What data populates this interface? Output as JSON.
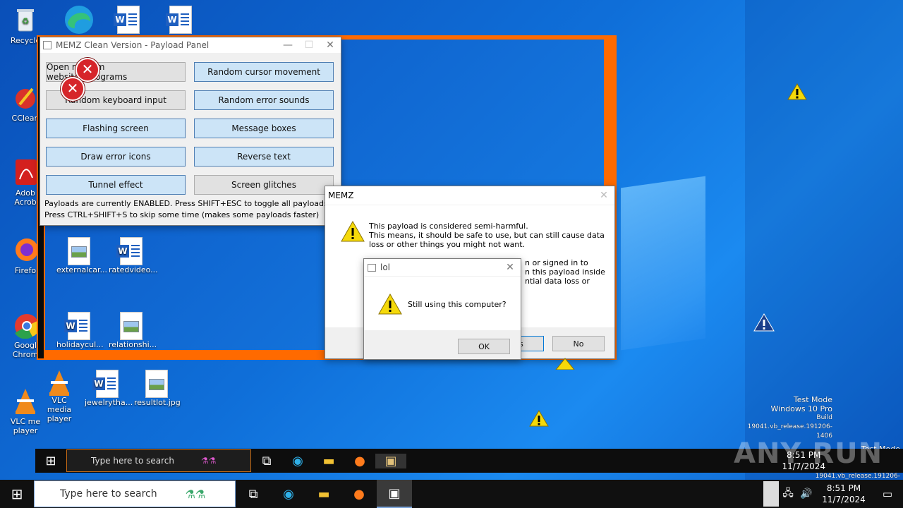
{
  "desktop": {
    "left_icons": [
      {
        "label": "Recycle",
        "icon": "recycle-bin-icon"
      },
      {
        "label": "CClean",
        "icon": "ccleaner-icon"
      },
      {
        "label": "Adob Acrob",
        "icon": "acrobat-icon"
      },
      {
        "label": "Firefo",
        "icon": "firefox-icon"
      },
      {
        "label": "Googl Chrom",
        "icon": "chrome-icon"
      },
      {
        "label": "VLC me player",
        "icon": "vlc-icon"
      }
    ],
    "files": [
      {
        "label": "externalcar...",
        "icon": "image-file-icon"
      },
      {
        "label": "ratedvideo...",
        "icon": "word-file-icon"
      },
      {
        "label": "holidaycul...",
        "icon": "word-file-icon"
      },
      {
        "label": "relationshi...",
        "icon": "image-file-icon"
      },
      {
        "label": "VLC media player",
        "icon": "vlc-icon"
      },
      {
        "label": "jewelrytha...",
        "icon": "word-file-icon"
      },
      {
        "label": "resultlot.jpg",
        "icon": "image-file-icon"
      }
    ]
  },
  "payload_panel": {
    "title": "MEMZ Clean Version - Payload Panel",
    "buttons": [
      {
        "label": "Open random websites/programs",
        "enabled": false
      },
      {
        "label": "Random cursor movement",
        "enabled": true
      },
      {
        "label": "Random keyboard input",
        "enabled": false
      },
      {
        "label": "Random error sounds",
        "enabled": true
      },
      {
        "label": "Flashing screen",
        "enabled": true
      },
      {
        "label": "Message boxes",
        "enabled": true
      },
      {
        "label": "Draw error icons",
        "enabled": true
      },
      {
        "label": "Reverse text",
        "enabled": true
      },
      {
        "label": "Tunnel effect",
        "enabled": true
      },
      {
        "label": "Screen glitches",
        "enabled": false
      }
    ],
    "status_line1": "Payloads are currently ENABLED. Press SHIFT+ESC to toggle all payloads!",
    "status_line2": "Press CTRL+SHIFT+S to skip some time (makes some payloads faster)"
  },
  "memz_dialog": {
    "title": "MEMZ",
    "line1": "This payload is considered semi-harmful.",
    "line2": "This means, it should be safe to use, but can still cause data",
    "line3": "loss or other things you might not want.",
    "line4": "n or signed in to",
    "line5": "n this payload inside",
    "line6": "ntial data loss or",
    "yes_fragment": "s",
    "no_label": "No"
  },
  "lol_dialog": {
    "title": "lol",
    "message": "Still using this computer?",
    "ok_label": "OK"
  },
  "taskbar": {
    "search_placeholder": "Type here to search",
    "time": "8:51 PM",
    "date": "11/7/2024"
  },
  "inner_taskbar": {
    "search_placeholder": "Type here to search",
    "time": "8:51 PM",
    "date": "11/7/2024"
  },
  "watermark": {
    "line1": "Test Mode",
    "line2": "Windows 10 Pro",
    "line3": "Build 19041.vb_release.191206-1406",
    "brand": "ANY RUN"
  },
  "colors": {
    "tunnel_orange": "#ff6a00",
    "desktop_blue": "#0f6fd9",
    "button_enabled": "#cce4f7"
  }
}
